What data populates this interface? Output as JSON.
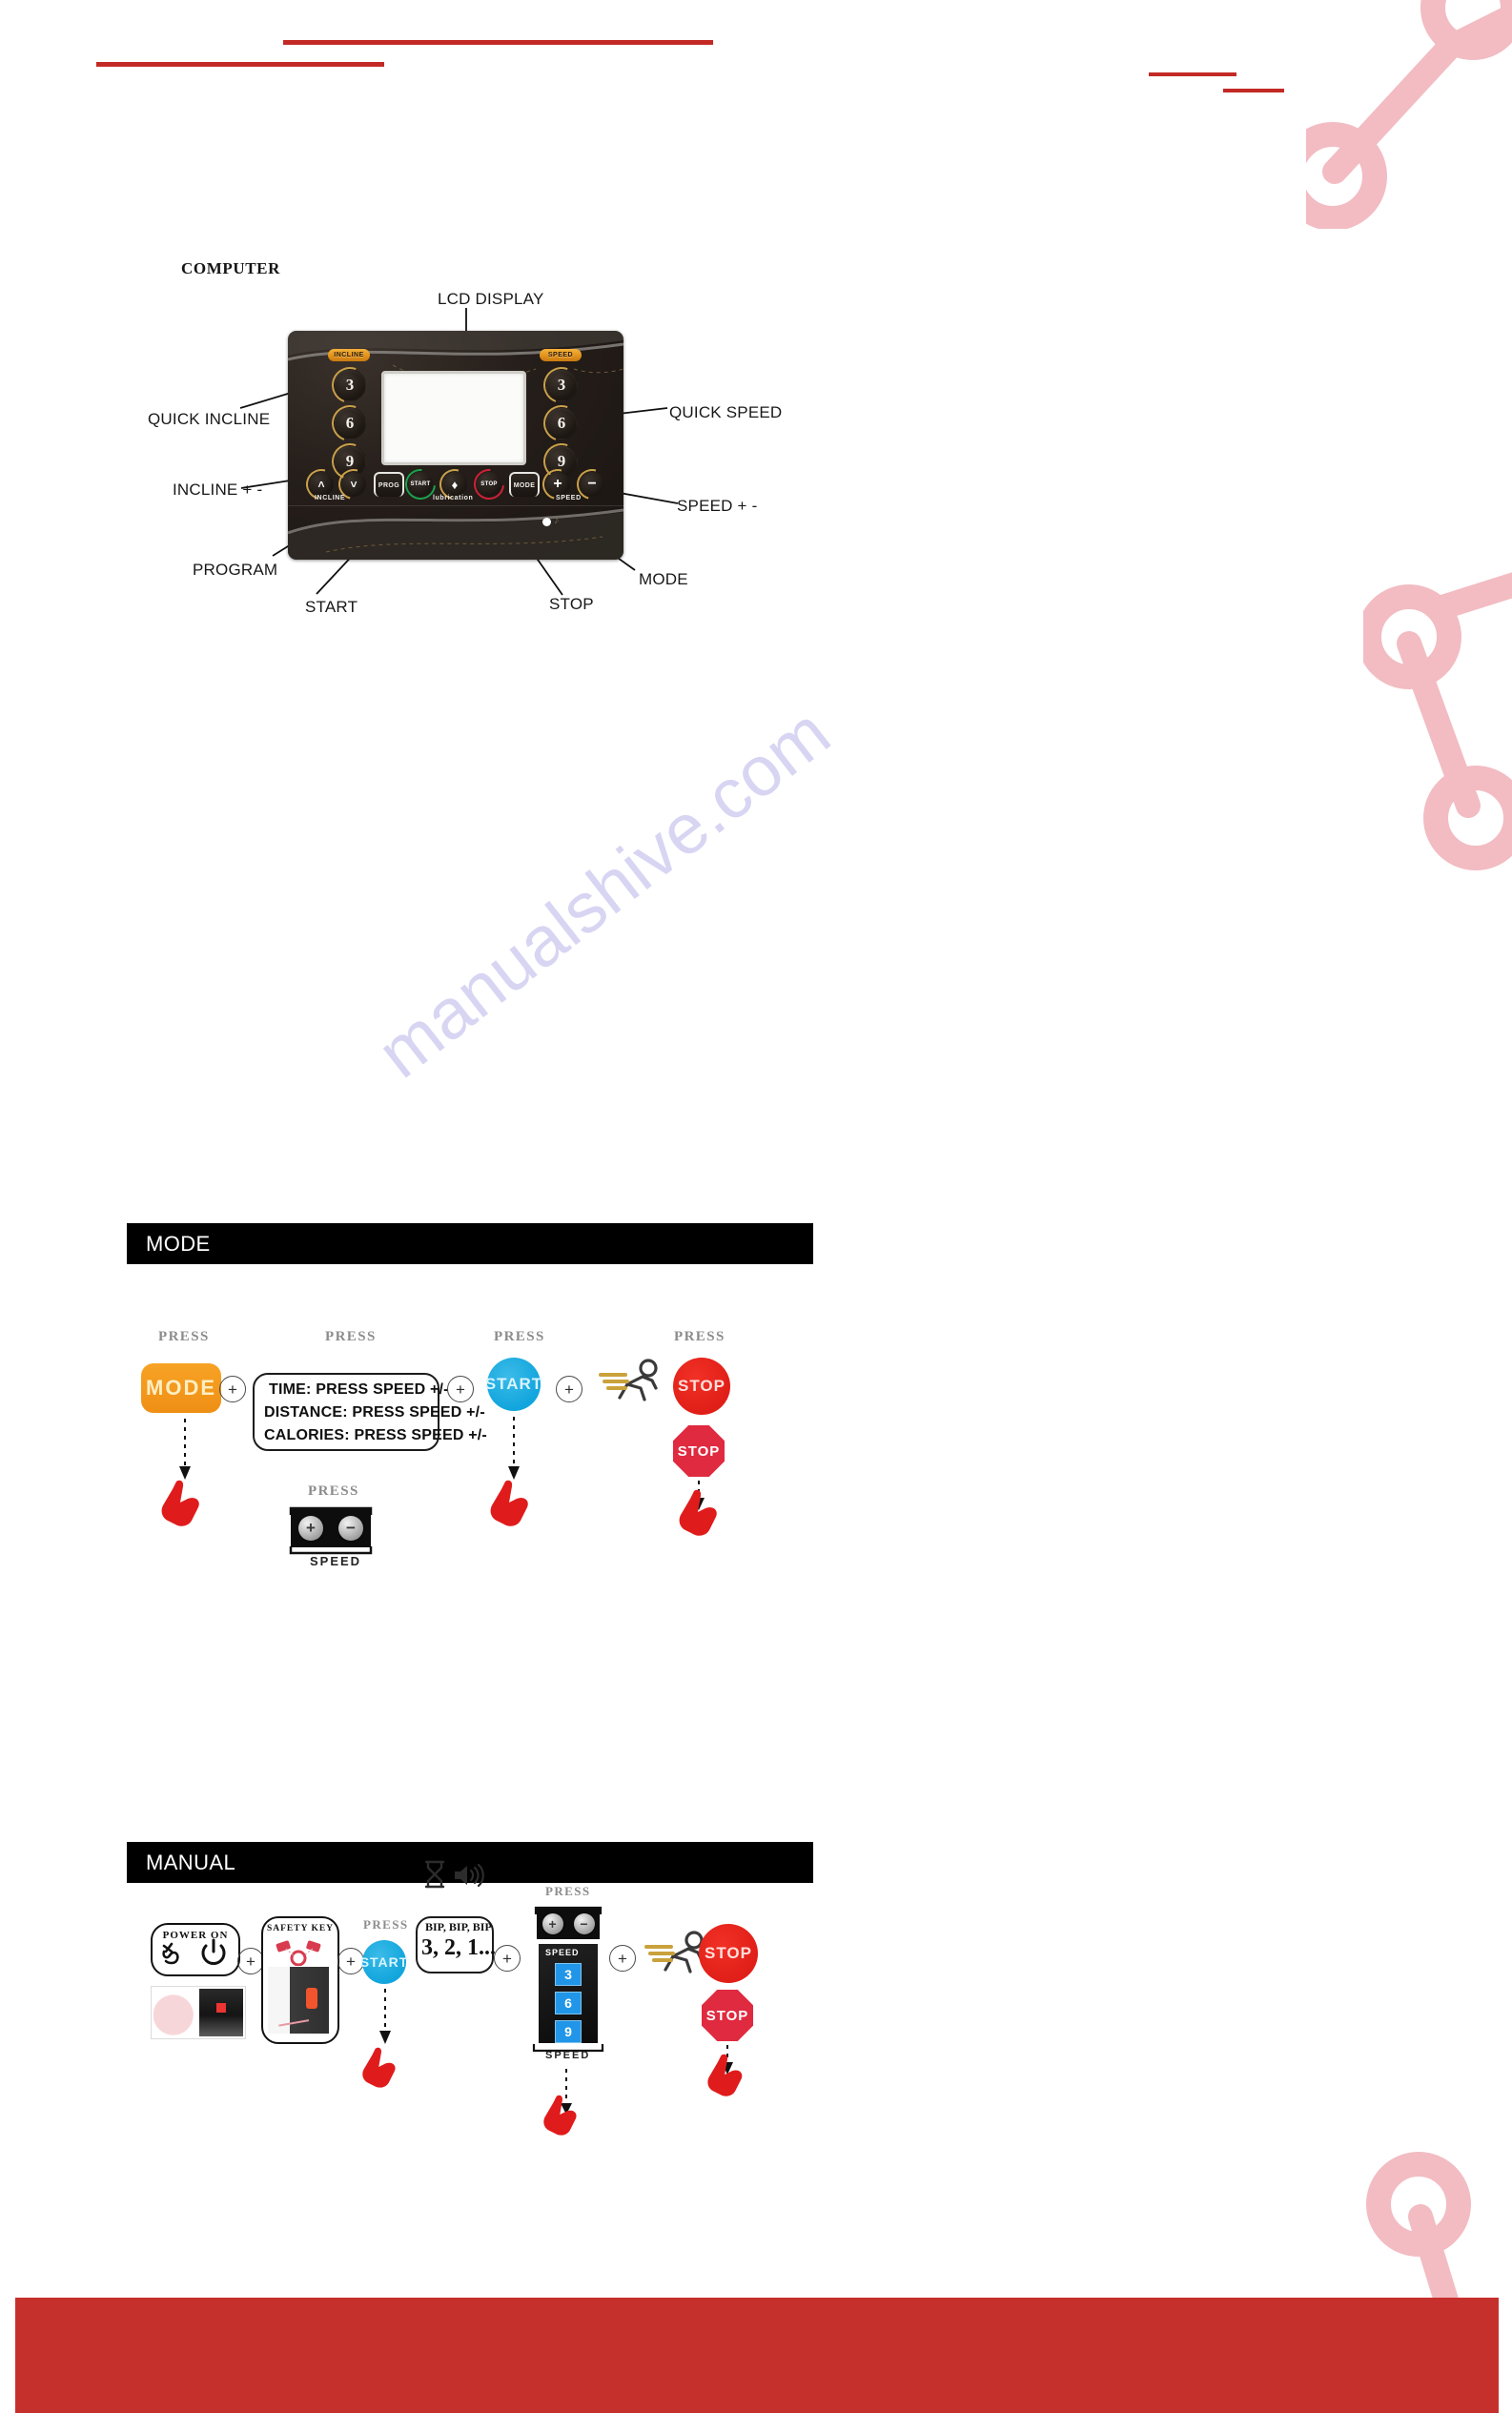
{
  "page": {
    "background": "#ffffff",
    "accent_red": "#c32a26",
    "accent_pink": "#f2bcc2",
    "watermark": "manualshive.com"
  },
  "computer_section": {
    "heading": "COMPUTER",
    "console": {
      "incline_pill": "INCLINE",
      "speed_pill": "SPEED",
      "quick_incline_values": [
        "3",
        "6",
        "9"
      ],
      "quick_speed_values": [
        "3",
        "6",
        "9"
      ],
      "bottom_buttons": [
        {
          "name": "incline-up",
          "label": "˄"
        },
        {
          "name": "incline-down",
          "label": "˅"
        },
        {
          "name": "prog",
          "label": "PROG"
        },
        {
          "name": "start",
          "label": "START"
        },
        {
          "name": "lubrication",
          "label": ""
        },
        {
          "name": "stop",
          "label": "STOP"
        },
        {
          "name": "mode",
          "label": "MODE"
        },
        {
          "name": "speed-plus",
          "label": "+"
        },
        {
          "name": "speed-minus",
          "label": "−"
        }
      ],
      "micro_labels": {
        "incline": "INCLINE",
        "lubrication": "lubrication",
        "speed": "SPEED"
      }
    },
    "callouts": [
      {
        "id": "lcd-display",
        "text": "LCD DISPLAY"
      },
      {
        "id": "quick-incline",
        "text": "QUICK INCLINE"
      },
      {
        "id": "quick-speed",
        "text": "QUICK SPEED"
      },
      {
        "id": "incline-plus-minus",
        "text": "INCLINE + -"
      },
      {
        "id": "speed-plus-minus",
        "text": "SPEED + -"
      },
      {
        "id": "program",
        "text": "PROGRAM"
      },
      {
        "id": "start",
        "text": "START"
      },
      {
        "id": "stop",
        "text": "STOP"
      },
      {
        "id": "mode",
        "text": "MODE"
      }
    ]
  },
  "mode_section": {
    "title": "MODE",
    "press_labels": [
      "PRESS",
      "PRESS",
      "PRESS",
      "PRESS",
      "PRESS"
    ],
    "mode_button_label": "MODE",
    "plus_symbol": "+",
    "instructions": [
      "TIME: PRESS SPEED +/-",
      "DISTANCE: PRESS SPEED +/-",
      "CALORIES: PRESS SPEED +/-"
    ],
    "speed_pad": {
      "press_label": "PRESS",
      "plus": "+",
      "minus": "−",
      "caption": "SPEED"
    },
    "start_button_label": "START",
    "stop_button_label": "STOP",
    "stop_sign_label": "STOP"
  },
  "manual_section": {
    "title": "MANUAL",
    "power_on": {
      "caption": "POWER ON"
    },
    "safety_key": {
      "caption": "SAFETY KEY"
    },
    "press_label": "PRESS",
    "start_button_label": "START",
    "countdown": {
      "beep_text": "BIP, BIP, BIP",
      "count_text": "3, 2, 1..."
    },
    "speed_panel": {
      "press_label": "PRESS",
      "plus": "+",
      "minus": "−",
      "header": "SPEED",
      "tiles": [
        "3",
        "6",
        "9"
      ],
      "caption": "SPEED"
    },
    "stop_button_label": "STOP",
    "stop_sign_label": "STOP",
    "plus_symbol": "+"
  }
}
